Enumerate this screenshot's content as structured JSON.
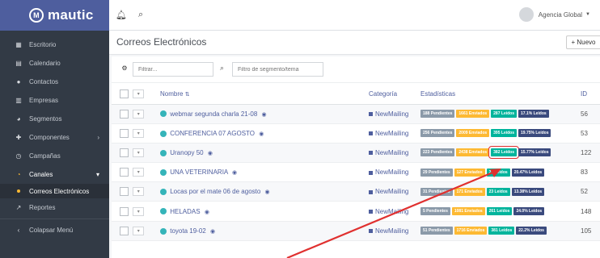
{
  "brand": {
    "name": "mautic"
  },
  "sidebar": {
    "items": [
      {
        "label": "Escritorio"
      },
      {
        "label": "Calendario"
      },
      {
        "label": "Contactos"
      },
      {
        "label": "Empresas"
      },
      {
        "label": "Segmentos"
      },
      {
        "label": "Componentes"
      },
      {
        "label": "Campañas"
      },
      {
        "label": "Canales"
      }
    ],
    "subitems": [
      {
        "label": "Correos Electrónicos"
      }
    ],
    "reports": "Reportes",
    "collapse": "Colapsar Menú"
  },
  "user": {
    "name": "Agencia Global"
  },
  "page": {
    "title": "Correos Electrónicos",
    "new_button": "+ Nuevo"
  },
  "filters": {
    "filter_placeholder": "Filtrar...",
    "segment_placeholder": "Filtro de segmento/tema"
  },
  "table": {
    "headers": {
      "name": "Nombre",
      "category": "Categoría",
      "stats": "Estadísticas",
      "id": "ID"
    },
    "rows": [
      {
        "name": "webmar segunda charla 21-08",
        "category": "NewMailing",
        "pending": "188 Pendientes",
        "sent": "1661 Enviados",
        "read": "287 Leídos",
        "pct": "17.1% Leídos",
        "id": "56"
      },
      {
        "name": "CONFERENCIA 07 AGOSTO",
        "category": "NewMailing",
        "pending": "256 Pendientes",
        "sent": "2009 Enviados",
        "read": "395 Leídos",
        "pct": "19.75% Leídos",
        "id": "53"
      },
      {
        "name": "Uranopy 50",
        "category": "NewMailing",
        "pending": "223 Pendientes",
        "sent": "2438 Enviados",
        "read": "382 Leídos",
        "pct": "15.77% Leídos",
        "id": "122"
      },
      {
        "name": "UNA VETERINARIA",
        "category": "NewMailing",
        "pending": "29 Pendientes",
        "sent": "127 Enviados",
        "read": "26 Leídos",
        "pct": "20.47% Leídos",
        "id": "83"
      },
      {
        "name": "Locas por el mate 06 de agosto",
        "category": "NewMailing",
        "pending": "31 Pendientes",
        "sent": "171 Enviados",
        "read": "23 Leídos",
        "pct": "13.38% Leídos",
        "id": "52"
      },
      {
        "name": "HELADAS",
        "category": "NewMailing",
        "pending": "5 Pendientes",
        "sent": "1081 Enviados",
        "read": "261 Leídos",
        "pct": "24.0% Leídos",
        "id": "148"
      },
      {
        "name": "toyota 19-02",
        "category": "NewMailing",
        "pending": "51 Pendientes",
        "sent": "1716 Enviados",
        "read": "381 Leídos",
        "pct": "22.2% Leídos",
        "id": "105"
      }
    ]
  },
  "colors": {
    "accent": "#4e5e9e",
    "sidebar": "#323a45",
    "pending": "#8b9aa9",
    "sent": "#fdb933",
    "read": "#00b49c",
    "percent": "#3a4a7d",
    "annotation": "#e0302f"
  }
}
